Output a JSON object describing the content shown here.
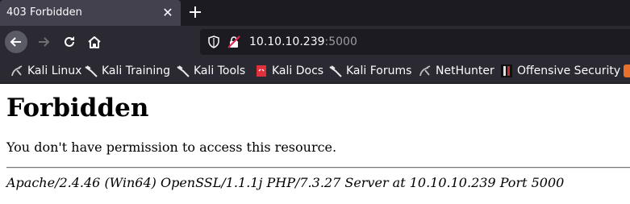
{
  "tab": {
    "title": "403 Forbidden"
  },
  "url": {
    "host": "10.10.10.239",
    "port": ":5000"
  },
  "bookmarks": [
    {
      "label": "Kali Linux",
      "icon": "kali-dragon-icon"
    },
    {
      "label": "Kali Training",
      "icon": "kali-dragon-icon"
    },
    {
      "label": "Kali Tools",
      "icon": "kali-dragon-icon"
    },
    {
      "label": "Kali Docs",
      "icon": "kali-docs-icon"
    },
    {
      "label": "Kali Forums",
      "icon": "kali-dragon-icon"
    },
    {
      "label": "NetHunter",
      "icon": "nethunter-icon"
    },
    {
      "label": "Offensive Security",
      "icon": "offsec-icon"
    }
  ],
  "page": {
    "heading": "Forbidden",
    "message": "You don't have permission to access this resource.",
    "address": "Apache/2.4.46 (Win64) OpenSSL/1.1.1j PHP/7.3.27 Server at 10.10.10.239 Port 5000"
  }
}
